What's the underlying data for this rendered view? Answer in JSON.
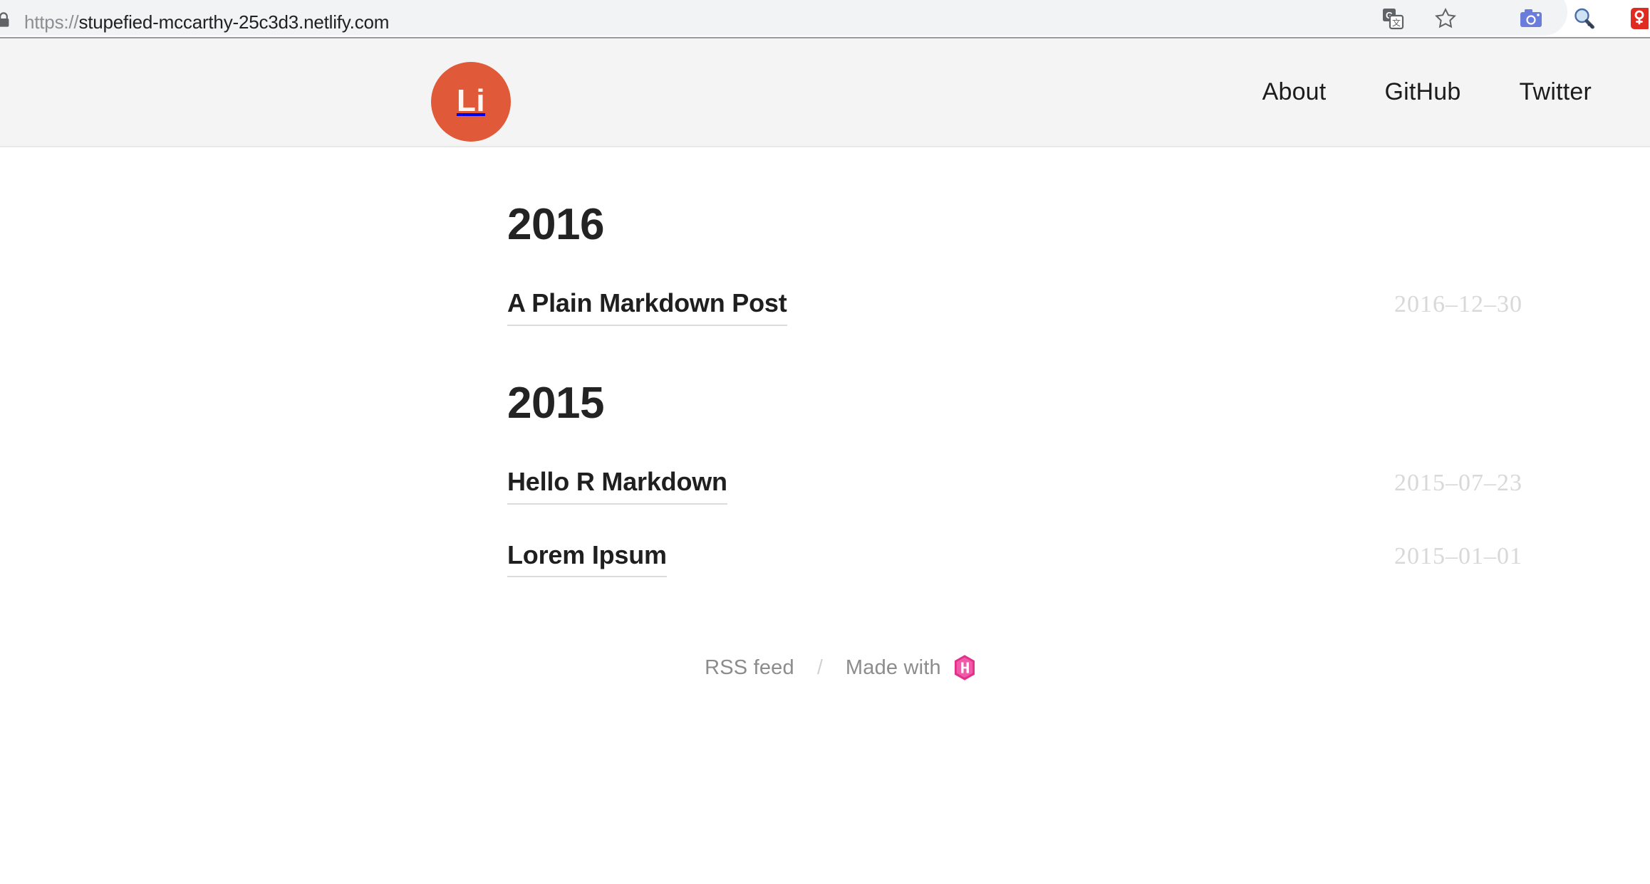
{
  "browser": {
    "url_scheme": "https://",
    "url_host": "stupefied-mccarthy-25c3d3.netlify.com",
    "url_full": "https://stupefied-mccarthy-25c3d3.netlify.com",
    "lock_icon": "lock-icon",
    "actions": [
      {
        "name": "google-translate-icon",
        "label": "Translate this page"
      },
      {
        "name": "bookmark-star-icon",
        "label": "Bookmark this tab"
      },
      {
        "name": "screenshot-camera-icon",
        "label": "Screenshot extension"
      },
      {
        "name": "magnifier-search-icon",
        "label": "Search extension"
      },
      {
        "name": "red-extension-icon",
        "label": "Extension"
      }
    ]
  },
  "header": {
    "logo_text": "Li",
    "logo_color": "#e05a39",
    "background": "#f4f4f4",
    "nav": [
      {
        "label": "About"
      },
      {
        "label": "GitHub"
      },
      {
        "label": "Twitter"
      }
    ]
  },
  "main": {
    "sections": [
      {
        "year": "2016",
        "posts": [
          {
            "title": "A Plain Markdown Post",
            "date": "2016–12–30"
          }
        ]
      },
      {
        "year": "2015",
        "posts": [
          {
            "title": "Hello R Markdown",
            "date": "2015–07–23"
          },
          {
            "title": "Lorem Ipsum",
            "date": "2015–01–01"
          }
        ]
      }
    ]
  },
  "footer": {
    "rss_label": "RSS feed",
    "separator": "/",
    "made_with_label": "Made with",
    "hugo_icon": "hugo-hexagon-icon",
    "hugo_color": "#e5308b"
  }
}
